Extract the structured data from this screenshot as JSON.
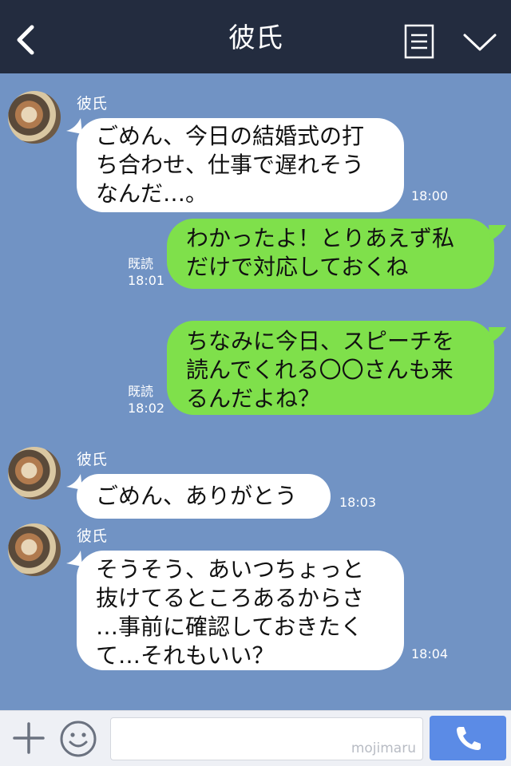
{
  "header": {
    "title": "彼氏"
  },
  "messages": [
    {
      "side": "in",
      "sender": "彼氏",
      "text": "ごめん、今日の結婚式の打\nち合わせ、仕事で遅れそう\nなんだ…。",
      "time": "18:00"
    },
    {
      "side": "out",
      "read": "既読",
      "text": "わかったよ！とりあえず私\nだけで対応しておくね",
      "time": "18:01"
    },
    {
      "side": "out",
      "read": "既読",
      "text": "ちなみに今日、スピーチを\n読んでくれる〇〇さんも来\nるんだよね？",
      "time": "18:02"
    },
    {
      "side": "in",
      "sender": "彼氏",
      "text": "ごめん、ありがとう",
      "time": "18:03"
    },
    {
      "side": "in",
      "sender": "彼氏",
      "text": "そうそう、あいつちょっと\n抜けてるところあるからさ\n…事前に確認しておきたく\nて…それもいい？",
      "time": "18:04"
    }
  ],
  "footer": {
    "input_value": "",
    "watermark": "mojimaru"
  },
  "colors": {
    "header": "#232c3f",
    "background": "#7193c4",
    "incoming": "#ffffff",
    "outgoing": "#7fe04b",
    "send": "#5b8be6"
  },
  "icons": {
    "back": "chevron-left-icon",
    "menu": "document-icon",
    "collapse": "chevron-down-icon",
    "add": "plus-icon",
    "emoji": "smile-icon",
    "call": "phone-icon"
  }
}
